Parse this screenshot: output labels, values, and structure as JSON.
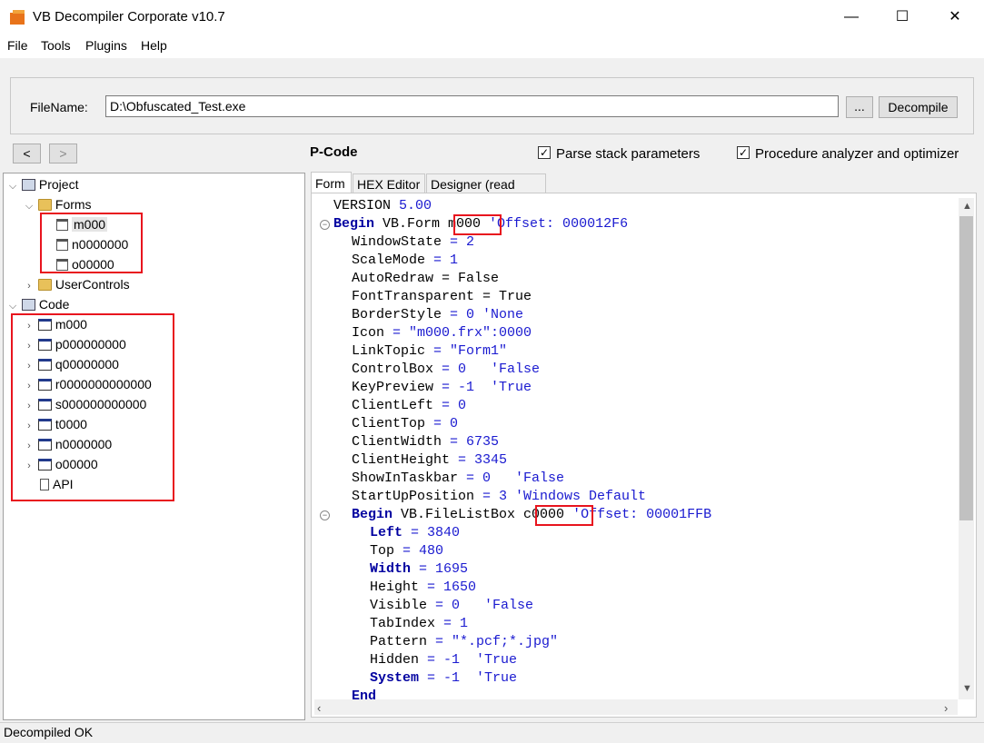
{
  "window": {
    "title": "VB Decompiler Corporate v10.7",
    "minimize": "—",
    "maximize": "☐",
    "close": "✕"
  },
  "menu": [
    "File",
    "Tools",
    "Plugins",
    "Help"
  ],
  "file": {
    "label": "FileName:",
    "value": "D:\\Obfuscated_Test.exe",
    "browse_label": "...",
    "decompile_label": "Decompile"
  },
  "nav": {
    "back": "<",
    "forward": ">"
  },
  "mode_label": "P-Code",
  "options": {
    "parse_stack": {
      "label": "Parse stack parameters",
      "checked": true
    },
    "proc_analyzer": {
      "label": "Procedure analyzer and optimizer",
      "checked": true
    }
  },
  "tree": {
    "project": "Project",
    "forms": "Forms",
    "form_items": [
      "m000",
      "n0000000",
      "o00000"
    ],
    "usercontrols": "UserControls",
    "code": "Code",
    "code_items": [
      "m000",
      "p000000000",
      "q00000000",
      "r0000000000000",
      "s000000000000",
      "t0000",
      "n0000000",
      "o00000"
    ],
    "api": "API"
  },
  "tabs": [
    "Form",
    "HEX Editor",
    "Designer (read only)"
  ],
  "active_tab": "Form",
  "code_lines": [
    {
      "indent": 0,
      "parts": [
        [
          "n",
          "VERSION "
        ],
        [
          "b",
          "5.00"
        ]
      ]
    },
    {
      "indent": 0,
      "fold": true,
      "parts": [
        [
          "k",
          "Begin"
        ],
        [
          "n",
          " VB.Form "
        ],
        [
          "n",
          "m000"
        ],
        [
          "b",
          " 'Offset: 000012F6"
        ]
      ]
    },
    {
      "indent": 1,
      "parts": [
        [
          "n",
          "WindowState "
        ],
        [
          "b",
          "= 2"
        ]
      ]
    },
    {
      "indent": 1,
      "parts": [
        [
          "n",
          "ScaleMode "
        ],
        [
          "b",
          "= 1"
        ]
      ]
    },
    {
      "indent": 1,
      "parts": [
        [
          "n",
          "AutoRedraw = False"
        ]
      ]
    },
    {
      "indent": 1,
      "parts": [
        [
          "n",
          "FontTransparent = True"
        ]
      ]
    },
    {
      "indent": 1,
      "parts": [
        [
          "n",
          "BorderStyle "
        ],
        [
          "b",
          "= 0 'None"
        ]
      ]
    },
    {
      "indent": 1,
      "parts": [
        [
          "n",
          "Icon "
        ],
        [
          "b",
          "= \"m000.frx\":0000"
        ]
      ]
    },
    {
      "indent": 1,
      "parts": [
        [
          "n",
          "LinkTopic "
        ],
        [
          "b",
          "= \"Form1\""
        ]
      ]
    },
    {
      "indent": 1,
      "parts": [
        [
          "n",
          "ControlBox "
        ],
        [
          "b",
          "= 0   'False"
        ]
      ]
    },
    {
      "indent": 1,
      "parts": [
        [
          "n",
          "KeyPreview "
        ],
        [
          "b",
          "= -1  'True"
        ]
      ]
    },
    {
      "indent": 1,
      "parts": [
        [
          "n",
          "ClientLeft "
        ],
        [
          "b",
          "= 0"
        ]
      ]
    },
    {
      "indent": 1,
      "parts": [
        [
          "n",
          "ClientTop "
        ],
        [
          "b",
          "= 0"
        ]
      ]
    },
    {
      "indent": 1,
      "parts": [
        [
          "n",
          "ClientWidth "
        ],
        [
          "b",
          "= 6735"
        ]
      ]
    },
    {
      "indent": 1,
      "parts": [
        [
          "n",
          "ClientHeight "
        ],
        [
          "b",
          "= 3345"
        ]
      ]
    },
    {
      "indent": 1,
      "parts": [
        [
          "n",
          "ShowInTaskbar "
        ],
        [
          "b",
          "= 0   'False"
        ]
      ]
    },
    {
      "indent": 1,
      "parts": [
        [
          "n",
          "StartUpPosition "
        ],
        [
          "b",
          "= 3 'Windows Default"
        ]
      ]
    },
    {
      "indent": 1,
      "fold": true,
      "parts": [
        [
          "k",
          "Begin"
        ],
        [
          "n",
          " VB.FileListBox "
        ],
        [
          "n",
          "c0000"
        ],
        [
          "b",
          " 'Offset: 00001FFB"
        ]
      ]
    },
    {
      "indent": 2,
      "parts": [
        [
          "k",
          "Left"
        ],
        [
          "b",
          " = 3840"
        ]
      ]
    },
    {
      "indent": 2,
      "parts": [
        [
          "n",
          "Top "
        ],
        [
          "b",
          "= 480"
        ]
      ]
    },
    {
      "indent": 2,
      "parts": [
        [
          "k",
          "Width"
        ],
        [
          "b",
          " = 1695"
        ]
      ]
    },
    {
      "indent": 2,
      "parts": [
        [
          "n",
          "Height "
        ],
        [
          "b",
          "= 1650"
        ]
      ]
    },
    {
      "indent": 2,
      "parts": [
        [
          "n",
          "Visible "
        ],
        [
          "b",
          "= 0   'False"
        ]
      ]
    },
    {
      "indent": 2,
      "parts": [
        [
          "n",
          "TabIndex "
        ],
        [
          "b",
          "= 1"
        ]
      ]
    },
    {
      "indent": 2,
      "parts": [
        [
          "n",
          "Pattern "
        ],
        [
          "b",
          "= \"*.pcf;*.jpg\""
        ]
      ]
    },
    {
      "indent": 2,
      "parts": [
        [
          "n",
          "Hidden "
        ],
        [
          "b",
          "= -1  'True"
        ]
      ]
    },
    {
      "indent": 2,
      "parts": [
        [
          "k",
          "System"
        ],
        [
          "b",
          " = -1  'True"
        ]
      ]
    },
    {
      "indent": 1,
      "parts": [
        [
          "k",
          "End"
        ]
      ]
    }
  ],
  "status": "Decompiled OK",
  "colors": {
    "highlight_box": "#e8141e",
    "keyword": "#0000a0",
    "literal": "#1a1ad0"
  }
}
